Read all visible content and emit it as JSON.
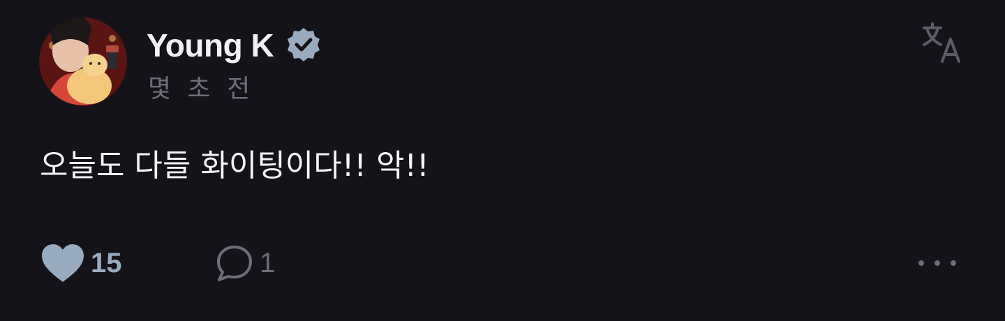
{
  "author": {
    "name": "Young K",
    "verified": true
  },
  "post": {
    "timestamp": "몇 초 전",
    "text": "오늘도 다들 화이팅이다!! 악!!"
  },
  "stats": {
    "likes": "15",
    "comments": "1"
  },
  "icons": {
    "verified": "verified-badge-icon",
    "translate": "translate-icon",
    "like": "heart-icon",
    "comment": "comment-bubble-icon",
    "more": "more-dots-icon"
  },
  "colors": {
    "background": "#141319",
    "text": "#f2f2f4",
    "muted": "#6f6e78",
    "accent": "#9aabc0"
  }
}
